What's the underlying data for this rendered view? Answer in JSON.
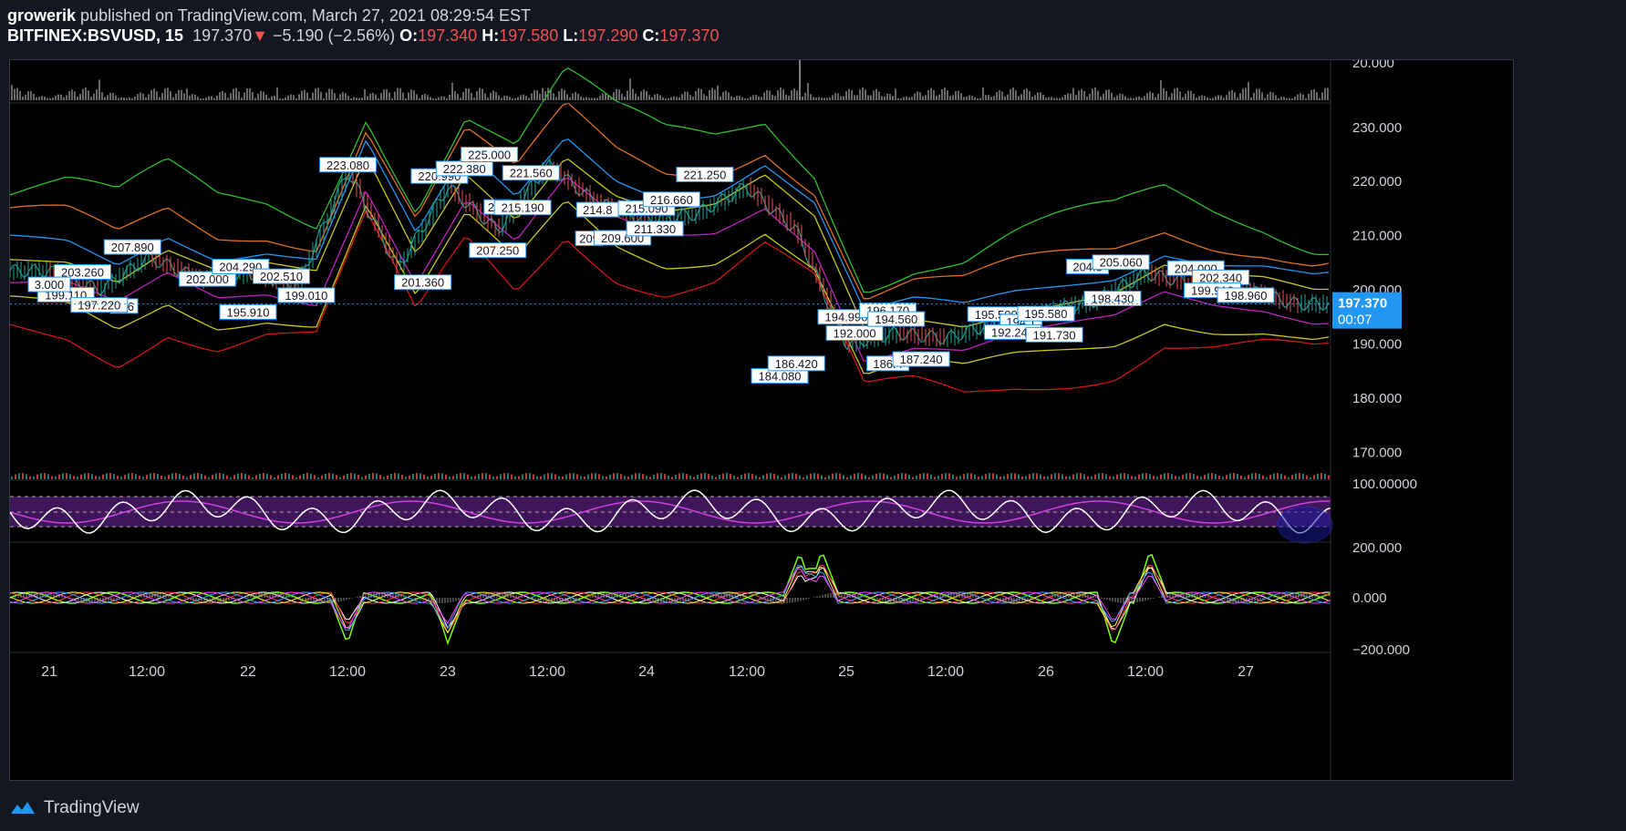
{
  "header": {
    "author": "growerik",
    "published": "published on TradingView.com, March 27, 2021 08:29:54 EST",
    "symbol": "BITFINEX:BSVUSD, 15",
    "last": "197.370",
    "change": "−5.190 (−2.56%)",
    "o_label": "O:",
    "o": "197.340",
    "h_label": "H:",
    "h": "197.580",
    "l_label": "L:",
    "l": "197.290",
    "c_label": "C:",
    "c": "197.370"
  },
  "footer": {
    "brand": "TradingView"
  },
  "price_tag": {
    "price": "197.370",
    "countdown": "00:07"
  },
  "volume_axis": {
    "label": "20.000"
  },
  "rsi_axis": {
    "label": "100.00000"
  },
  "osc_axis": {
    "labels": [
      "200.000",
      "0.000",
      "−200.000"
    ]
  },
  "x_axis": {
    "labels": [
      "21",
      "12:00",
      "22",
      "12:00",
      "23",
      "12:00",
      "24",
      "12:00",
      "25",
      "12:00",
      "26",
      "12:00",
      "27"
    ]
  },
  "colors": {
    "bg": "#000000",
    "up": "#26a69a",
    "down": "#ef5350",
    "tag": "#2196f3"
  },
  "chart_data": {
    "type": "line",
    "title": "BITFINEX:BSVUSD, 15",
    "y_ticks": [
      230,
      220,
      210,
      200,
      190,
      180,
      170
    ],
    "ylim": [
      165,
      234
    ],
    "x": [
      "21 00:00",
      "21 06:00",
      "21 12:00",
      "21 18:00",
      "22 00:00",
      "22 06:00",
      "22 12:00",
      "22 18:00",
      "23 00:00",
      "23 06:00",
      "23 12:00",
      "23 18:00",
      "24 00:00",
      "24 06:00",
      "24 12:00",
      "24 18:00",
      "25 00:00",
      "25 06:00",
      "25 12:00",
      "25 18:00",
      "26 00:00",
      "26 06:00",
      "26 12:00",
      "26 18:00",
      "27 00:00",
      "27 06:00"
    ],
    "series": [
      {
        "values": [
          203.5,
          200,
          206,
          202,
          203,
          201,
          222,
          204,
          219,
          211,
          223,
          216,
          213,
          214,
          219,
          211,
          190,
          192,
          191,
          194,
          196,
          198,
          203,
          201,
          200,
          197.4
        ]
      }
    ],
    "price_labels": [
      {
        "text": "203.260",
        "x": "21 04:00",
        "y": 203.3
      },
      {
        "text": "199.110",
        "x": "21 02:00",
        "y": 199.1
      },
      {
        "text": "196",
        "x": "21 09:00",
        "y": 197
      },
      {
        "text": "197.220",
        "x": "21 06:00",
        "y": 197.2
      },
      {
        "text": "207.890",
        "x": "21 10:00",
        "y": 207.9
      },
      {
        "text": "202.000",
        "x": "21 19:00",
        "y": 202.0
      },
      {
        "text": "204.290",
        "x": "21 23:00",
        "y": 204.3
      },
      {
        "text": "195.910",
        "x": "22 00:00",
        "y": 195.9
      },
      {
        "text": "202.510",
        "x": "22 04:00",
        "y": 202.5
      },
      {
        "text": "199.010",
        "x": "22 07:00",
        "y": 199.0
      },
      {
        "text": "223.080",
        "x": "22 12:00",
        "y": 223.1
      },
      {
        "text": "201.360",
        "x": "22 21:00",
        "y": 201.4
      },
      {
        "text": "207.250",
        "x": "23 06:00",
        "y": 207.3
      },
      {
        "text": "220.990",
        "x": "22 23:00",
        "y": 221.0
      },
      {
        "text": "222.380",
        "x": "23 02:00",
        "y": 222.4
      },
      {
        "text": "225.000",
        "x": "23 05:00",
        "y": 225.0
      },
      {
        "text": "221.560",
        "x": "23 10:00",
        "y": 221.6
      },
      {
        "text": "215",
        "x": "23 06:00",
        "y": 215.3
      },
      {
        "text": "215.190",
        "x": "23 09:00",
        "y": 215.2
      },
      {
        "text": "214.8",
        "x": "23 18:00",
        "y": 214.8
      },
      {
        "text": "215.090",
        "x": "24 00:00",
        "y": 215.1
      },
      {
        "text": "216.660",
        "x": "24 03:00",
        "y": 216.7
      },
      {
        "text": "209",
        "x": "23 17:00",
        "y": 209.5
      },
      {
        "text": "209.600",
        "x": "23 21:00",
        "y": 209.6
      },
      {
        "text": "211.330",
        "x": "24 01:00",
        "y": 211.3
      },
      {
        "text": "221.250",
        "x": "24 07:00",
        "y": 221.3
      },
      {
        "text": "184.080",
        "x": "24 16:00",
        "y": 184.1
      },
      {
        "text": "186.420",
        "x": "24 18:00",
        "y": 186.4
      },
      {
        "text": "194.990",
        "x": "25 00:00",
        "y": 195.0
      },
      {
        "text": "192.000",
        "x": "25 01:00",
        "y": 192.0
      },
      {
        "text": "196.170",
        "x": "25 05:00",
        "y": 196.2
      },
      {
        "text": "194.560",
        "x": "25 06:00",
        "y": 194.6
      },
      {
        "text": "186.4",
        "x": "25 05:00",
        "y": 186.4
      },
      {
        "text": "187.240",
        "x": "25 09:00",
        "y": 187.2
      },
      {
        "text": "195.500",
        "x": "25 18:00",
        "y": 195.5
      },
      {
        "text": "194.1",
        "x": "25 21:00",
        "y": 194.1
      },
      {
        "text": "195.580",
        "x": "26 00:00",
        "y": 195.6
      },
      {
        "text": "192.240",
        "x": "25 20:00",
        "y": 192.2
      },
      {
        "text": "191.730",
        "x": "26 01:00",
        "y": 191.7
      },
      {
        "text": "204.3",
        "x": "26 05:00",
        "y": 204.3
      },
      {
        "text": "205.060",
        "x": "26 09:00",
        "y": 205.1
      },
      {
        "text": "198.430",
        "x": "26 08:00",
        "y": 198.4
      },
      {
        "text": "204.000",
        "x": "26 18:00",
        "y": 204.0
      },
      {
        "text": "202.340",
        "x": "26 21:00",
        "y": 202.3
      },
      {
        "text": "199.910",
        "x": "26 20:00",
        "y": 199.9
      },
      {
        "text": "198.960",
        "x": "27 00:00",
        "y": 199.0
      },
      {
        "text": "3.000",
        "x": "21 00:00",
        "y": 201.0
      }
    ]
  }
}
